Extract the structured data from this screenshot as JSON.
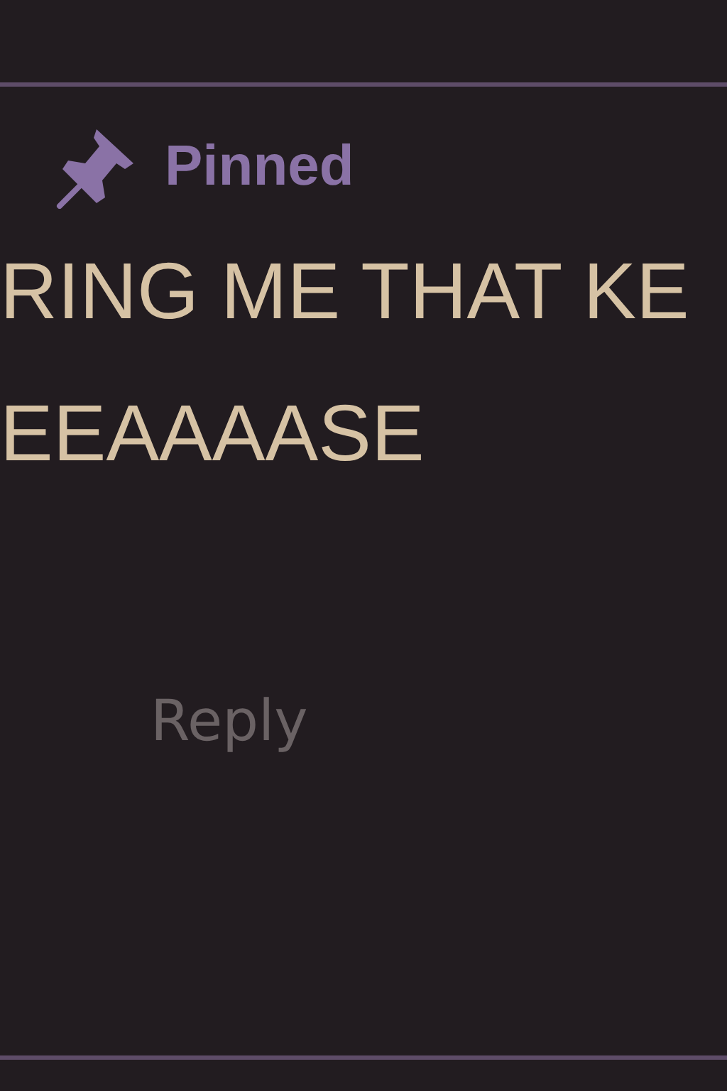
{
  "comment": {
    "pinned_label": "Pinned",
    "text_lines": [
      "RING ME THAT KE",
      "EEAAAASE"
    ],
    "reply": "Reply"
  }
}
